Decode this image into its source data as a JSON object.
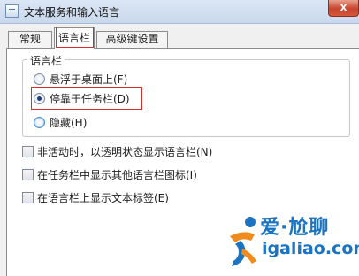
{
  "window": {
    "title": "文本服务和输入语言",
    "close_glyph": "x"
  },
  "tabs": [
    {
      "label": "常规"
    },
    {
      "label": "语言栏"
    },
    {
      "label": "高级键设置"
    }
  ],
  "language_bar_group": {
    "title": "语言栏",
    "options": [
      {
        "label": "悬浮于桌面上(F)",
        "selected": false
      },
      {
        "label": "停靠于任务栏(D)",
        "selected": true
      },
      {
        "label": "隐藏(H)",
        "selected": false
      }
    ]
  },
  "checkboxes": [
    {
      "label": "非活动时，以透明状态显示语言栏(N)",
      "checked": false
    },
    {
      "label": "在任务栏中显示其他语言栏图标(I)",
      "checked": false
    },
    {
      "label": "在语言栏上显示文本标签(E)",
      "checked": false
    }
  ],
  "watermark": {
    "text_cn": "爱·尬聊",
    "url": "igaliao.com"
  },
  "colors": {
    "highlight_border": "#d92b2b",
    "watermark_blue": "#1a74c2",
    "watermark_orange": "#f08c1e"
  }
}
